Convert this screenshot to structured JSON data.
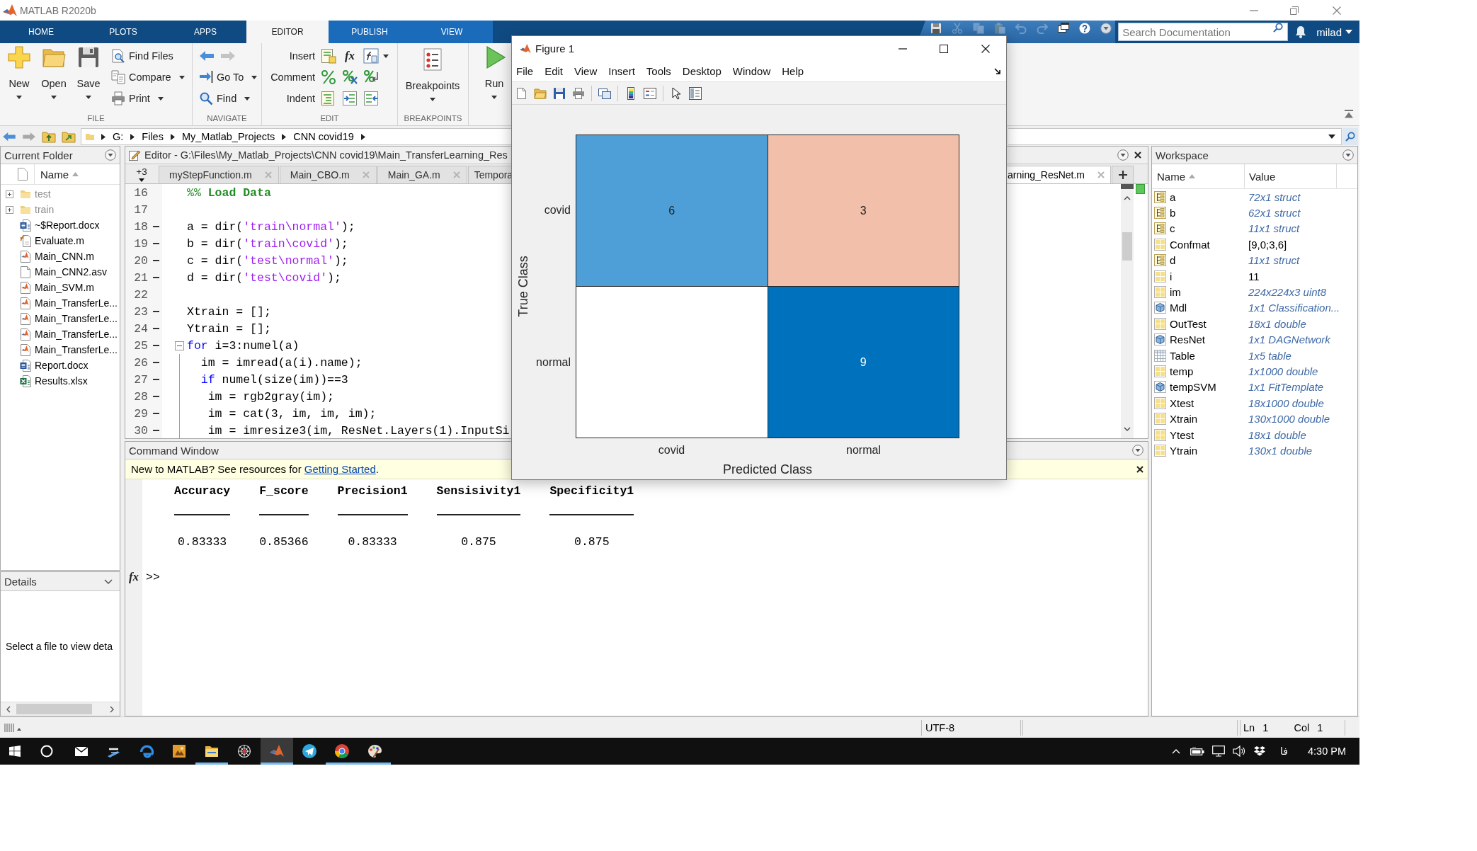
{
  "window": {
    "title": "MATLAB R2020b"
  },
  "ribbon_tabs": [
    {
      "label": "HOME",
      "selected": false,
      "contextual": false
    },
    {
      "label": "PLOTS",
      "selected": false,
      "contextual": false
    },
    {
      "label": "APPS",
      "selected": false,
      "contextual": false
    },
    {
      "label": "EDITOR",
      "selected": true,
      "contextual": true
    },
    {
      "label": "PUBLISH",
      "selected": false,
      "contextual": true
    },
    {
      "label": "VIEW",
      "selected": false,
      "contextual": true
    }
  ],
  "quick_access": [
    {
      "kind": "save",
      "disabled": false
    },
    {
      "kind": "cut",
      "disabled": true
    },
    {
      "kind": "copy",
      "disabled": true
    },
    {
      "kind": "paste",
      "disabled": true
    },
    {
      "kind": "undo",
      "disabled": true
    },
    {
      "kind": "redo",
      "disabled": true
    },
    {
      "kind": "windows",
      "disabled": false
    },
    {
      "kind": "help",
      "disabled": false
    },
    {
      "kind": "options",
      "disabled": false
    }
  ],
  "search": {
    "placeholder": "Search Documentation"
  },
  "user": {
    "name": "milad"
  },
  "toolstrip": {
    "file": {
      "label": "FILE",
      "items": [
        {
          "label": "New",
          "kind": "large",
          "dropdown": true
        },
        {
          "label": "Open",
          "kind": "large",
          "dropdown": true
        },
        {
          "label": "Save",
          "kind": "large",
          "dropdown": true
        },
        {
          "label": "Find Files",
          "kind": "small",
          "dropdown": false
        },
        {
          "label": "Compare",
          "kind": "small",
          "dropdown": true
        },
        {
          "label": "Print",
          "kind": "small",
          "dropdown": true
        }
      ]
    },
    "navigate": {
      "label": "NAVIGATE",
      "back": {
        "disabled": false
      },
      "forward": {
        "disabled": true
      },
      "items": [
        {
          "label": "Go To",
          "dropdown": true
        },
        {
          "label": "Find",
          "dropdown": true
        }
      ]
    },
    "edit": {
      "label": "EDIT",
      "function_glyph": "fx",
      "rows": [
        {
          "label": "Insert",
          "dropdown": true
        },
        {
          "label": "Comment",
          "dropdown": false
        },
        {
          "label": "Indent",
          "dropdown": false
        }
      ]
    },
    "breakpoints": {
      "label": "BREAKPOINTS",
      "items": [
        {
          "label": "Breakpoints",
          "dropdown": true
        }
      ]
    },
    "run": {
      "items": [
        {
          "label": "Run",
          "dropdown": true
        }
      ]
    }
  },
  "address_bar": {
    "back": {
      "disabled": false
    },
    "forward": {
      "disabled": true
    },
    "path": [
      "G:",
      "Files",
      "My_Matlab_Projects",
      "CNN covid19"
    ]
  },
  "current_folder": {
    "title": "Current Folder",
    "column": {
      "label": "Name",
      "sorted": true
    },
    "files": [
      {
        "name": "test",
        "kind": "folder",
        "expanded": false
      },
      {
        "name": "train",
        "kind": "folder",
        "expanded": false
      },
      {
        "name": "~$Report.docx",
        "kind": "word"
      },
      {
        "name": "Evaluate.m",
        "kind": "function"
      },
      {
        "name": "Main_CNN.m",
        "kind": "script"
      },
      {
        "name": "Main_CNN2.asv",
        "kind": "file"
      },
      {
        "name": "Main_SVM.m",
        "kind": "script"
      },
      {
        "name": "Main_TransferLe...",
        "kind": "script"
      },
      {
        "name": "Main_TransferLe...",
        "kind": "script"
      },
      {
        "name": "Main_TransferLe...",
        "kind": "script"
      },
      {
        "name": "Main_TransferLe...",
        "kind": "script"
      },
      {
        "name": "Report.docx",
        "kind": "word"
      },
      {
        "name": "Results.xlsx",
        "kind": "excel"
      }
    ]
  },
  "details": {
    "title": "Details",
    "message": "Select a file to view deta"
  },
  "editor": {
    "title": "Editor - G:\\Files\\My_Matlab_Projects\\CNN covid19\\Main_TransferLearning_Res",
    "overflow": "+3",
    "tabs_left": [
      {
        "label": "myStepFunction.m",
        "selected": false,
        "close": true
      },
      {
        "label": "Main_CBO.m",
        "selected": false,
        "close": true
      },
      {
        "label": "Main_GA.m",
        "selected": false,
        "close": true
      },
      {
        "label": "Tempora",
        "selected": false,
        "close": false
      }
    ],
    "tabs_right": [
      {
        "label": "arning_ResNet.m",
        "selected": true,
        "close": true
      }
    ],
    "lines": [
      {
        "number": "16",
        "executable": false,
        "tokens": [
          {
            "text": "%%",
            "kind": "comment"
          },
          {
            "text": " Load Data",
            "kind": "section"
          }
        ]
      },
      {
        "number": "17",
        "executable": false
      },
      {
        "number": "18",
        "executable": true,
        "tokens": [
          {
            "text": "a = dir(",
            "kind": "plain"
          },
          {
            "text": "'train\\normal'",
            "kind": "string"
          },
          {
            "text": ");",
            "kind": "plain"
          }
        ]
      },
      {
        "number": "19",
        "executable": true,
        "tokens": [
          {
            "text": "b = dir(",
            "kind": "plain"
          },
          {
            "text": "'train\\covid'",
            "kind": "string"
          },
          {
            "text": ");",
            "kind": "plain"
          }
        ]
      },
      {
        "number": "20",
        "executable": true,
        "tokens": [
          {
            "text": "c = dir(",
            "kind": "plain"
          },
          {
            "text": "'test\\normal'",
            "kind": "string"
          },
          {
            "text": ");",
            "kind": "plain"
          }
        ]
      },
      {
        "number": "21",
        "executable": true,
        "tokens": [
          {
            "text": "d = dir(",
            "kind": "plain"
          },
          {
            "text": "'test\\covid'",
            "kind": "string"
          },
          {
            "text": ");",
            "kind": "plain"
          }
        ]
      },
      {
        "number": "22",
        "executable": false
      },
      {
        "number": "23",
        "executable": true,
        "tokens": [
          {
            "text": "Xtrain = [];",
            "kind": "plain"
          }
        ]
      },
      {
        "number": "24",
        "executable": true,
        "tokens": [
          {
            "text": "Ytrain = [];",
            "kind": "plain"
          }
        ]
      },
      {
        "number": "25",
        "executable": true,
        "expanded": true,
        "tokens": [
          {
            "text": "for",
            "kind": "keyword"
          },
          {
            "text": " i=3:numel(a)",
            "kind": "plain"
          }
        ],
        "children": [
          {
            "number": "26",
            "executable": true,
            "tokens": [
              {
                "text": "  im = imread(a(i).name);",
                "kind": "plain"
              }
            ]
          },
          {
            "number": "27",
            "executable": true,
            "tokens": [
              {
                "text": "  if",
                "kind": "keyword"
              },
              {
                "text": " numel(size(im))==3",
                "kind": "plain"
              }
            ]
          },
          {
            "number": "28",
            "executable": true,
            "tokens": [
              {
                "text": "   im = rgb2gray(im);",
                "kind": "plain"
              }
            ]
          },
          {
            "number": "29",
            "executable": true,
            "tokens": [
              {
                "text": "   im = cat(3, im, im, im);",
                "kind": "plain"
              }
            ]
          },
          {
            "number": "30",
            "executable": true,
            "tokens": [
              {
                "text": "   im = imresize3(im, ResNet.Layers(1).InputSi",
                "kind": "plain"
              }
            ]
          }
        ]
      }
    ]
  },
  "workspace": {
    "title": "Workspace",
    "columns": [
      {
        "label": "Name",
        "sorted": true
      },
      {
        "label": "Value",
        "sorted": false
      }
    ],
    "variables": [
      {
        "name": "a",
        "value": "72x1 struct",
        "kind": "struct",
        "literal": false
      },
      {
        "name": "b",
        "value": "62x1 struct",
        "kind": "struct",
        "literal": false
      },
      {
        "name": "c",
        "value": "11x1 struct",
        "kind": "struct",
        "literal": false
      },
      {
        "name": "Confmat",
        "value": "[9,0;3,6]",
        "kind": "matrix",
        "literal": true
      },
      {
        "name": "d",
        "value": "11x1 struct",
        "kind": "struct",
        "literal": false
      },
      {
        "name": "i",
        "value": "11",
        "kind": "matrix",
        "literal": true
      },
      {
        "name": "im",
        "value": "224x224x3 uint8",
        "kind": "matrix",
        "literal": false
      },
      {
        "name": "Mdl",
        "value": "1x1 Classification...",
        "kind": "object",
        "literal": false
      },
      {
        "name": "OutTest",
        "value": "18x1 double",
        "kind": "matrix",
        "literal": false
      },
      {
        "name": "ResNet",
        "value": "1x1 DAGNetwork",
        "kind": "object",
        "literal": false
      },
      {
        "name": "Table",
        "value": "1x5 table",
        "kind": "table",
        "literal": false
      },
      {
        "name": "temp",
        "value": "1x1000 double",
        "kind": "matrix",
        "literal": false
      },
      {
        "name": "tempSVM",
        "value": "1x1 FitTemplate",
        "kind": "object",
        "literal": false
      },
      {
        "name": "Xtest",
        "value": "18x1000 double",
        "kind": "matrix",
        "literal": false
      },
      {
        "name": "Xtrain",
        "value": "130x1000 double",
        "kind": "matrix",
        "literal": false
      },
      {
        "name": "Ytest",
        "value": "18x1 double",
        "kind": "matrix",
        "literal": false
      },
      {
        "name": "Ytrain",
        "value": "130x1 double",
        "kind": "matrix",
        "literal": false
      }
    ]
  },
  "command_window": {
    "title": "Command Window",
    "notice": {
      "before": "New to MATLAB? See resources for ",
      "link": "Getting Started",
      "after": "."
    },
    "table": [
      {
        "header": "Accuracy",
        "value": "0.83333"
      },
      {
        "header": "F_score",
        "value": "0.85366"
      },
      {
        "header": "Precision1",
        "value": "0.83333"
      },
      {
        "header": "Sensisivity1",
        "value": "0.875"
      },
      {
        "header": "Specificity1",
        "value": "0.875"
      }
    ],
    "function_glyph": "fx",
    "prompt": ">>"
  },
  "status_bar": {
    "encoding": "UTF-8",
    "position": [
      {
        "label": "Ln",
        "value": "1"
      },
      {
        "label": "Col",
        "value": "1"
      }
    ]
  },
  "taskbar": {
    "apps": [
      {
        "kind": "mail",
        "running": false,
        "selected": false
      },
      {
        "kind": "pen",
        "running": false,
        "selected": false
      },
      {
        "kind": "swirl",
        "running": false,
        "selected": false
      },
      {
        "kind": "picture",
        "running": false,
        "selected": false
      },
      {
        "kind": "folder",
        "running": true,
        "selected": false
      },
      {
        "kind": "web",
        "running": false,
        "selected": false
      },
      {
        "kind": "peak",
        "running": true,
        "selected": true
      },
      {
        "kind": "plane",
        "running": false,
        "selected": false
      },
      {
        "kind": "ring",
        "running": true,
        "selected": false
      },
      {
        "kind": "palette",
        "running": true,
        "selected": false
      }
    ],
    "language": "فا",
    "time": "4:30 PM"
  },
  "figure": {
    "title": "Figure 1",
    "menu": [
      "File",
      "Edit",
      "View",
      "Insert",
      "Tools",
      "Desktop",
      "Window",
      "Help"
    ],
    "chart": {
      "ylabel": "True Class",
      "xlabel": "Predicted Class",
      "row_labels": [
        "covid",
        "normal"
      ],
      "column_labels": [
        "covid",
        "normal"
      ],
      "cells": [
        [
          {
            "value": "6",
            "color": "#4e9fd8"
          },
          {
            "value": "3",
            "color": "#f2bfab"
          }
        ],
        [
          {
            "color": "#ffffff"
          },
          {
            "value": "9",
            "color": "#0072bd"
          }
        ]
      ]
    }
  }
}
